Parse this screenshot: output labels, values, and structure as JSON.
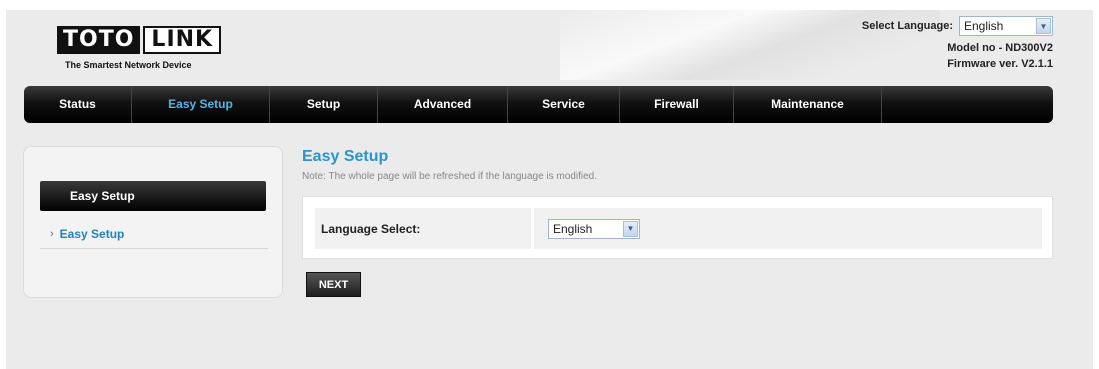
{
  "brand": {
    "logo_word1": "TOTO",
    "logo_word2": "LINK",
    "tagline": "The Smartest Network Device"
  },
  "header": {
    "language_label": "Select Language:",
    "language_value": "English",
    "model": "Model no - ND300V2",
    "firmware": "Firmware ver. V2.1.1"
  },
  "nav": {
    "items": [
      {
        "label": "Status"
      },
      {
        "label": "Easy Setup",
        "active": true
      },
      {
        "label": "Setup"
      },
      {
        "label": "Advanced"
      },
      {
        "label": "Service"
      },
      {
        "label": "Firewall"
      },
      {
        "label": "Maintenance"
      }
    ]
  },
  "sidebar": {
    "header": "Easy Setup",
    "items": [
      {
        "label": "Easy Setup"
      }
    ]
  },
  "main": {
    "title": "Easy Setup",
    "note": "Note: The whole page will be refreshed if the language is modified.",
    "language_select_label": "Language Select:",
    "language_select_value": "English",
    "next_label": "NEXT"
  },
  "colors": {
    "accent": "#2a95cc",
    "nav_active": "#4fb8e8",
    "nav_bg": "#000000"
  },
  "icons": {
    "select_arrow": "chevron-down-icon",
    "sidebar_bullet": "chevron-right-icon"
  }
}
